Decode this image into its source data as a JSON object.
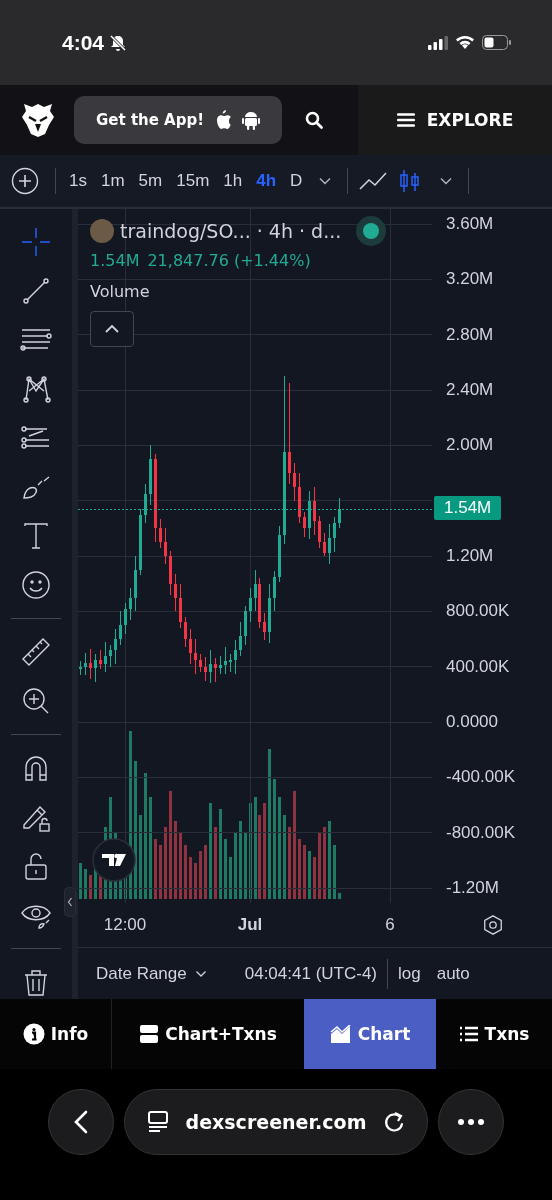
{
  "status_bar": {
    "time": "4:04"
  },
  "header": {
    "app_button": "Get the App!",
    "explore": "EXPLORE"
  },
  "timeframes": [
    {
      "label": "1s",
      "selected": false
    },
    {
      "label": "1m",
      "selected": false
    },
    {
      "label": "5m",
      "selected": false
    },
    {
      "label": "15m",
      "selected": false
    },
    {
      "label": "1h",
      "selected": false
    },
    {
      "label": "4h",
      "selected": true
    },
    {
      "label": "D",
      "selected": false
    }
  ],
  "chart_types": [
    {
      "kind": "line",
      "selected": false
    },
    {
      "kind": "candles",
      "selected": true
    }
  ],
  "tools": [
    {
      "kind": "crosshair",
      "selected": true
    },
    {
      "kind": "trend-line",
      "selected": false
    },
    {
      "kind": "fib",
      "selected": false
    },
    {
      "kind": "pattern",
      "selected": false
    },
    {
      "kind": "projection",
      "selected": false
    },
    {
      "kind": "brush",
      "selected": false
    },
    {
      "kind": "text",
      "selected": false
    },
    {
      "kind": "emoji",
      "selected": false
    },
    {
      "kind": "divider"
    },
    {
      "kind": "ruler",
      "selected": false
    },
    {
      "kind": "zoom",
      "selected": false
    },
    {
      "kind": "divider"
    },
    {
      "kind": "magnet",
      "selected": false
    },
    {
      "kind": "lock-drawing",
      "selected": false
    },
    {
      "kind": "lock",
      "selected": false
    },
    {
      "kind": "eye",
      "selected": false
    },
    {
      "kind": "divider"
    },
    {
      "kind": "trash",
      "selected": false
    }
  ],
  "legend": {
    "symbol": "traindog/SO...",
    "interval": "· 4h · d...",
    "volume_value": "1.54M",
    "price": "21,847.76 (+1.44%)",
    "indicator": "Volume"
  },
  "chart_data": {
    "type": "candlestick",
    "ylim": [
      -1308000,
      3709000
    ],
    "grid": true,
    "ref_lines": [
      {
        "axis": "y",
        "value": 1540000,
        "label": "1.54M"
      }
    ],
    "yticks": [
      {
        "value": 3600000,
        "label": "3.60M"
      },
      {
        "value": 3200000,
        "label": "3.20M"
      },
      {
        "value": 2800000,
        "label": "2.80M"
      },
      {
        "value": 2400000,
        "label": "2.40M"
      },
      {
        "value": 2000000,
        "label": "2.00M"
      },
      {
        "value": 1200000,
        "label": "1.20M"
      },
      {
        "value": 800000,
        "label": "800.00K"
      },
      {
        "value": 400000,
        "label": "400.00K"
      },
      {
        "value": 0,
        "label": "0.0000"
      },
      {
        "value": -400000,
        "label": "-400.00K"
      },
      {
        "value": -800000,
        "label": "-800.00K"
      },
      {
        "value": -1200000,
        "label": "-1.20M"
      }
    ],
    "categories": [
      null,
      null,
      null,
      null,
      null,
      null,
      null,
      null,
      null,
      null,
      null,
      null,
      null,
      null,
      null,
      null,
      null,
      null,
      null,
      null,
      null,
      null,
      null,
      null,
      null,
      null,
      null,
      null,
      null,
      null,
      null,
      null,
      null,
      null,
      null,
      null,
      null,
      null,
      null,
      null,
      null,
      null,
      null,
      null,
      null,
      null,
      null,
      null,
      null,
      null,
      null,
      null,
      null,
      null,
      null,
      null,
      null,
      null,
      null,
      null,
      null,
      null,
      null,
      null,
      null,
      null,
      null,
      null,
      null,
      null,
      null
    ],
    "ohlc": [
      [
        380000,
        440000,
        340000,
        400000
      ],
      [
        400000,
        500000,
        340000,
        430000
      ],
      [
        430000,
        530000,
        310000,
        390000
      ],
      [
        390000,
        490000,
        290000,
        450000
      ],
      [
        450000,
        520000,
        380000,
        420000
      ],
      [
        420000,
        580000,
        360000,
        480000
      ],
      [
        480000,
        560000,
        400000,
        520000
      ],
      [
        520000,
        670000,
        420000,
        600000
      ],
      [
        600000,
        800000,
        560000,
        700000
      ],
      [
        700000,
        860000,
        640000,
        820000
      ],
      [
        820000,
        970000,
        740000,
        900000
      ],
      [
        900000,
        1200000,
        800000,
        1100000
      ],
      [
        1100000,
        1540000,
        1060000,
        1500000
      ],
      [
        1500000,
        1720000,
        1440000,
        1650000
      ],
      [
        1650000,
        2000000,
        1570000,
        1900000
      ],
      [
        1900000,
        1940000,
        1300000,
        1400000
      ],
      [
        1400000,
        1470000,
        1260000,
        1300000
      ],
      [
        1300000,
        1400000,
        1140000,
        1200000
      ],
      [
        1200000,
        1240000,
        920000,
        1000000
      ],
      [
        1000000,
        1070000,
        800000,
        900000
      ],
      [
        900000,
        1000000,
        680000,
        720000
      ],
      [
        720000,
        760000,
        540000,
        600000
      ],
      [
        600000,
        670000,
        420000,
        500000
      ],
      [
        500000,
        600000,
        350000,
        450000
      ],
      [
        450000,
        490000,
        360000,
        400000
      ],
      [
        400000,
        470000,
        300000,
        360000
      ],
      [
        360000,
        520000,
        280000,
        420000
      ],
      [
        420000,
        460000,
        290000,
        390000
      ],
      [
        390000,
        480000,
        350000,
        410000
      ],
      [
        410000,
        540000,
        350000,
        440000
      ],
      [
        440000,
        490000,
        360000,
        450000
      ],
      [
        450000,
        590000,
        350000,
        520000
      ],
      [
        520000,
        720000,
        480000,
        620000
      ],
      [
        620000,
        840000,
        560000,
        800000
      ],
      [
        800000,
        970000,
        720000,
        900000
      ],
      [
        900000,
        1100000,
        800000,
        1000000
      ],
      [
        1000000,
        1040000,
        680000,
        720000
      ],
      [
        720000,
        790000,
        590000,
        650000
      ],
      [
        650000,
        1000000,
        570000,
        900000
      ],
      [
        900000,
        1090000,
        800000,
        1050000
      ],
      [
        1050000,
        1420000,
        1010000,
        1350000
      ],
      [
        1350000,
        2500000,
        1290000,
        1950000
      ],
      [
        1950000,
        2450000,
        1720000,
        1800000
      ],
      [
        1800000,
        1870000,
        1600000,
        1700000
      ],
      [
        1700000,
        1800000,
        1440000,
        1480000
      ],
      [
        1480000,
        1520000,
        1340000,
        1400000
      ],
      [
        1400000,
        1670000,
        1320000,
        1600000
      ],
      [
        1600000,
        1700000,
        1350000,
        1450000
      ],
      [
        1450000,
        1490000,
        1260000,
        1300000
      ],
      [
        1300000,
        1370000,
        1200000,
        1220000
      ],
      [
        1220000,
        1430000,
        1140000,
        1330000
      ],
      [
        1330000,
        1480000,
        1230000,
        1440000
      ],
      [
        1440000,
        1620000,
        1400000,
        1540000
      ],
      null,
      null,
      null,
      null,
      null,
      null,
      null,
      null,
      null,
      null,
      null,
      null,
      null,
      null,
      null,
      null,
      null,
      null
    ]
  },
  "time_axis": [
    {
      "label": "12:00",
      "bold": false
    },
    {
      "label": "Jul",
      "bold": true
    },
    {
      "label": "6",
      "bold": false
    }
  ],
  "footer": {
    "date_range": "Date Range",
    "clock": "04:04:41 (UTC-4)",
    "log": "log",
    "auto": "auto"
  },
  "tabs": [
    {
      "label": "Info",
      "kind": "info",
      "selected": false
    },
    {
      "label": "Chart+Txns",
      "kind": "split",
      "selected": false
    },
    {
      "label": "Chart",
      "kind": "chart",
      "selected": true
    },
    {
      "label": "Txns",
      "kind": "list",
      "selected": false
    }
  ],
  "browser": {
    "url": "dexscreener.com"
  }
}
